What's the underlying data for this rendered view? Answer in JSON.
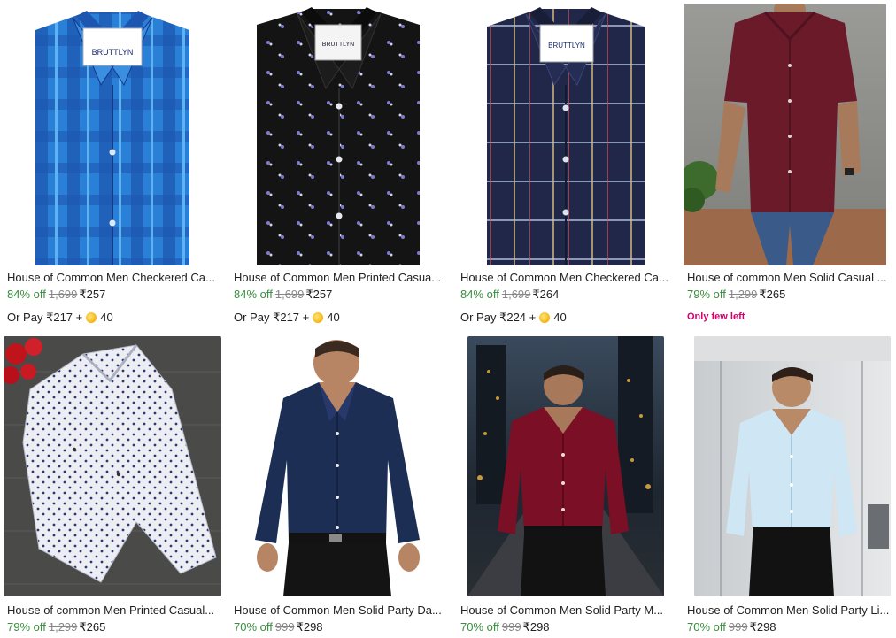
{
  "products": [
    {
      "title": "House of Common Men Checkered Ca...",
      "discount": "84% off",
      "mrp": "1,699",
      "price": "₹257",
      "pay_prefix": "Or Pay ₹217 +",
      "coins": "40",
      "shirt_color": "#2a7fd6",
      "accent": "#143a8c",
      "label_text": "BRUTTLYN"
    },
    {
      "title": "House of Common Men Printed Casua...",
      "discount": "84% off",
      "mrp": "1,699",
      "price": "₹257",
      "pay_prefix": "Or Pay ₹217 +",
      "coins": "40",
      "shirt_color": "#141414",
      "accent": "#6a6ab8",
      "label_text": "BRUTTLYN"
    },
    {
      "title": "House of Common Men Checkered Ca...",
      "discount": "84% off",
      "mrp": "1,699",
      "price": "₹264",
      "pay_prefix": "Or Pay ₹224 +",
      "coins": "40",
      "shirt_color": "#202748",
      "accent": "#c9b07a",
      "label_text": "BRUTTLYN"
    },
    {
      "title": "House of common Men Solid Casual ...",
      "discount": "79% off",
      "mrp": "1,299",
      "price": "₹265",
      "note": "Only few left",
      "shirt_color": "#6b1a2a",
      "accent": "#3a5a8a"
    },
    {
      "title": "House of common Men Printed Casual...",
      "discount": "79% off",
      "mrp": "1,299",
      "price": "₹265",
      "shirt_color": "#eceef4",
      "accent": "#2e3a6e"
    },
    {
      "title": "House of Common Men Solid Party Da...",
      "discount": "70% off",
      "mrp": "999",
      "price": "₹298",
      "shirt_color": "#1d2e55",
      "accent": "#121212"
    },
    {
      "title": "House of Common Men Solid Party M...",
      "discount": "70% off",
      "mrp": "999",
      "price": "₹298",
      "shirt_color": "#7a0f25",
      "accent": "#121212"
    },
    {
      "title": "House of Common Men Solid Party Li...",
      "discount": "70% off",
      "mrp": "999",
      "price": "₹298",
      "shirt_color": "#cfe6f5",
      "accent": "#121212"
    }
  ]
}
